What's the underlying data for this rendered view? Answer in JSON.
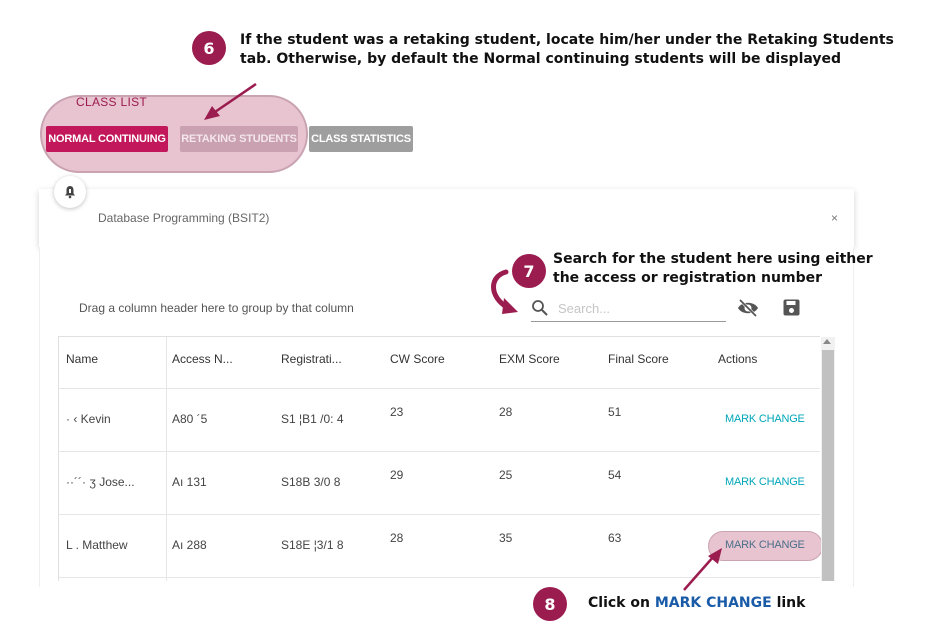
{
  "steps": [
    {
      "number": "6",
      "text_line1": "If the student was a retaking student, locate him/her under the Retaking Students",
      "text_line2": "tab. Otherwise, by default the Normal continuing students will be displayed"
    },
    {
      "number": "7",
      "text_line1": "Search for the student here using either",
      "text_line2": "the access or registration number"
    },
    {
      "number": "8",
      "prefix": "Click on ",
      "highlight": "MARK CHANGE",
      "suffix": " link"
    }
  ],
  "class_list": {
    "title": "CLASS LIST",
    "tabs": [
      "NORMAL CONTINUING",
      "RETAKING STUDENTS",
      "CLASS STATISTICS"
    ]
  },
  "panel": {
    "title": "Database Programming (BSIT2)",
    "close": "×"
  },
  "toolbar": {
    "group_hint": "Drag a column header here to group by that column",
    "search_placeholder": "Search..."
  },
  "table": {
    "headers": [
      "Name",
      "Access N...",
      "Registrati...",
      "CW Score",
      "EXM Score",
      "Final Score",
      "Actions"
    ],
    "rows": [
      {
        "name": "·       ‹ Kevin",
        "access": "A80  ´5",
        "registration": "S1 ¦B1  /0: 4",
        "cw": "23",
        "exm": "28",
        "final": "51",
        "action": "MARK CHANGE"
      },
      {
        "name": "··´´· ʒ Jose...",
        "access": "Aı  131",
        "registration": "S18B  3/0  8",
        "cw": "29",
        "exm": "25",
        "final": "54",
        "action": "MARK CHANGE"
      },
      {
        "name": "L     . Matthew",
        "access": "Aı  288",
        "registration": "S18E ¦3/1  8",
        "cw": "28",
        "exm": "35",
        "final": "63",
        "action": "MARK CHANGE"
      }
    ]
  },
  "colors": {
    "accent": "#9b1c4f",
    "tab_active": "#c2185b",
    "link": "#00a6b8",
    "highlight_overlay": "#e8c3d0"
  }
}
